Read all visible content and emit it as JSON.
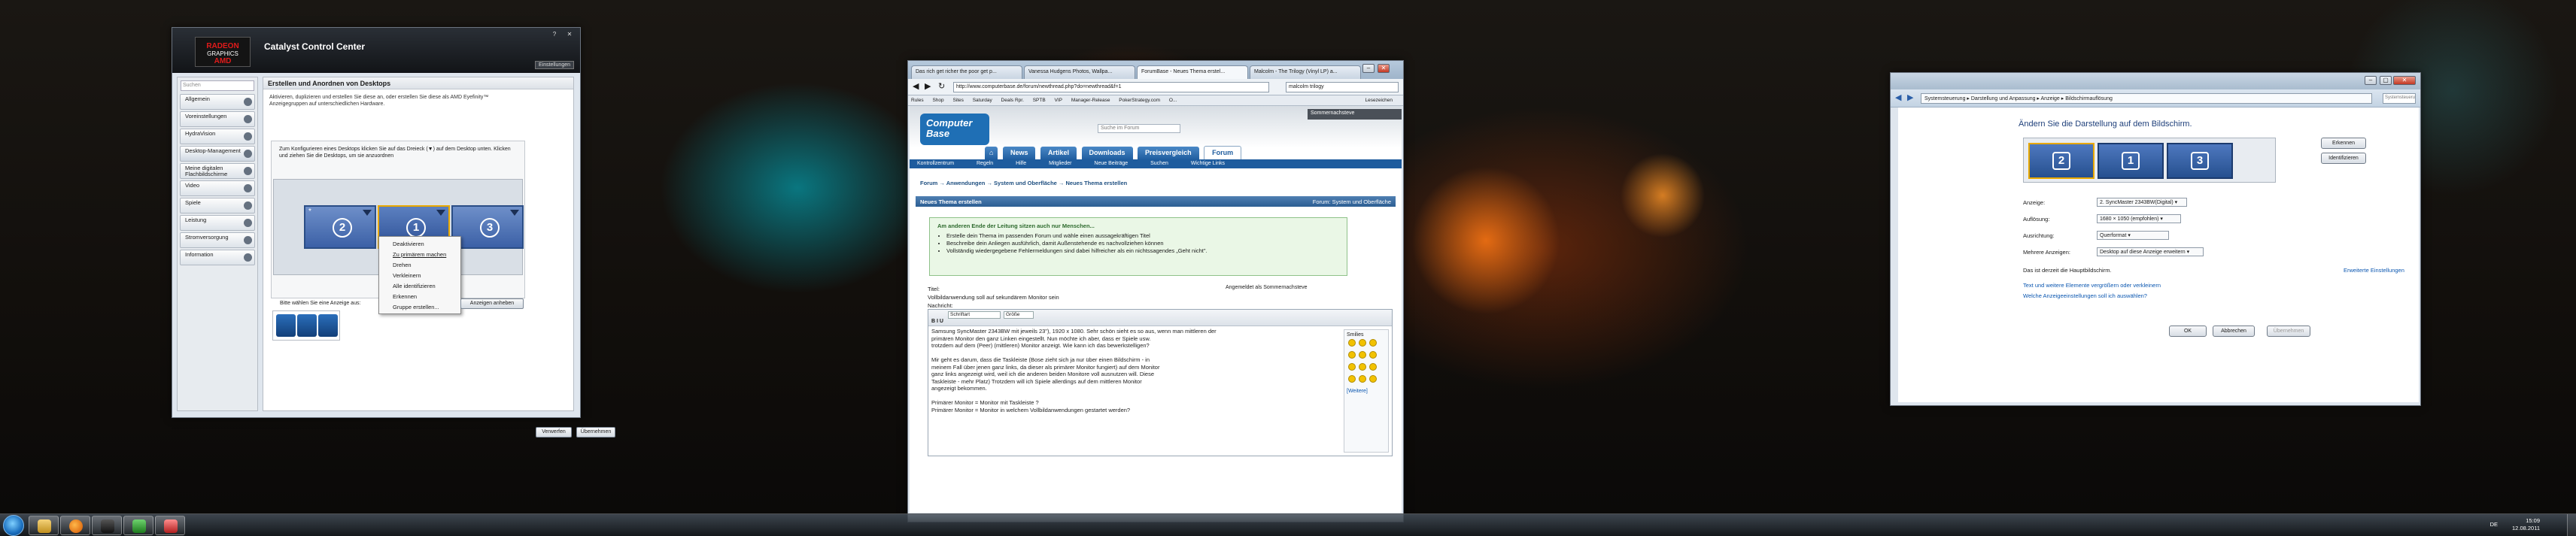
{
  "ccc": {
    "logo_line1": "RADEON",
    "logo_line2": "GRAPHICS",
    "brand": "AMD",
    "title": "Catalyst Control Center",
    "preferences": "Einstellungen",
    "search_placeholder": "Suchen",
    "sidebar": [
      "Allgemein",
      "Voreinstellungen",
      "HydraVision",
      "Desktop-Management",
      "Meine digitalen Flachbildschirme",
      "Video",
      "Spiele",
      "Leistung",
      "Stromversorgung",
      "Information"
    ],
    "heading": "Erstellen und Anordnen von Desktops",
    "description": "Aktivieren, duplizieren und erstellen Sie diese an, oder erstellen Sie diese als AMD Eyefinity™ Anzeigegruppen auf unterschiedlichen Hardware.",
    "instruction": "Zum Konfigurieren eines Desktops klicken Sie auf das Dreieck (▼) auf dem Desktop unten. Klicken und ziehen Sie die Desktops, um sie anzuordnen",
    "monitors": [
      "2",
      "1",
      "3"
    ],
    "context_menu": [
      "Deaktivieren",
      "Zu primärem machen",
      "Drehen",
      "Verkleinern",
      "Alle identifizieren",
      "Erkennen",
      "Gruppe erstellen..."
    ],
    "select_label": "Bitte wählen Sie eine Anzeige aus:",
    "hide_btn": "Anzeigen anheben",
    "discard_btn": "Verwerfen",
    "apply_btn": "Übernehmen"
  },
  "browser": {
    "tabs": [
      "Das rich get richer the poor get p...",
      "Vanessa Hudgens Photos, Wallpa...",
      "ForumBase - Neues Thema erstel...",
      "Malcolm - The Trilogy (Vinyl LP) a..."
    ],
    "url": "http://www.computerbase.de/forum/newthread.php?do=newthread&f=1",
    "search": "malcolm trilogy",
    "bookmarks": [
      "Rules",
      "Shop",
      "Sites",
      "Saturday",
      "Deals Rpr.",
      "SPTB",
      "VIP",
      "Manager-Release",
      "PokerStrategy.com",
      "O...",
      "Lesezeichen"
    ],
    "logo": "Computer Base",
    "user": "Sommernachsteve",
    "site_search": "Suche im Forum",
    "nav": [
      "News",
      "Artikel",
      "Downloads",
      "Preisvergleich",
      "Forum"
    ],
    "subnav": [
      "Kontrollzentrum",
      "Regeln",
      "Hilfe",
      "Mitglieder",
      "Neue Beiträge",
      "Suchen",
      "Wichtige Links"
    ],
    "breadcrumb": "Forum → Anwendungen → System und Oberfläche → Neues Thema erstellen",
    "section": "Neues Thema erstellen",
    "section_right": "Forum: System und Oberfläche",
    "notice_title": "Am anderen Ende der Leitung sitzen auch nur Menschen...",
    "notice_items": [
      "Erstelle dein Thema im passenden Forum und wähle einen aussagekräftigen Titel",
      "Beschreibe dein Anliegen ausführlich, damit Außenstehende es nachvollziehen können",
      "Vollständig wiedergegebene Fehlermeldungen sind dabei hilfreicher als ein nichtssagendes „Geht nicht\"."
    ],
    "title_label": "Titel:",
    "title_value": "Vollbildanwendung soll auf sekundärem Monitor sein",
    "logged_in": "Angemeldet als Sommernachsteve",
    "message_label": "Nachricht:",
    "font": "Schriftart",
    "size": "Größe",
    "body": [
      "Samsung SyncMaster 2343BW mit jeweils 23\"), 1920 x 1080. Sehr schön sieht es so aus, wenn man mittleren der",
      "primären Monitor den ganz Linken eingestellt. Nun möchte ich aber, dass er Spiele usw.",
      "trotzdem auf dem (Peer) (mittleren) Monitor anzeigt. Wie kann ich das bewerkstelligen?",
      "",
      "Mir geht es darum, dass die Taskleiste (Bose zieht sich ja nur über einen Bildschirm - in",
      "meinem Fall über jenen ganz links, da dieser als primärer Monitor fungiert) auf dem Monitor",
      "ganz links angezeigt wird, weil ich die anderen beiden Monitore voll ausnutzen will. Diese",
      "Taskleiste - mehr Platz) Trotzdem will ich Spiele allerdings auf dem mittleren Monitor",
      "angezeigt bekommen.",
      "",
      "Primärer Monitor = Monitor mit Taskleiste ?",
      "Primärer Monitor = Monitor in welchem Vollbildanwendungen gestartet werden?"
    ],
    "smilies_title": "Smilies",
    "smilies_more": "[Weitere]"
  },
  "display": {
    "crumb": "Systemsteuerung ▸ Darstellung und Anpassung ▸ Anzeige ▸ Bildschirmauflösung",
    "search": "Systemsteuerung durchsuchen",
    "heading": "Ändern Sie die Darstellung auf dem Bildschirm.",
    "monitors": [
      "2",
      "1",
      "3"
    ],
    "detect": "Erkennen",
    "identify": "Identifizieren",
    "rows": [
      {
        "label": "Anzeige:",
        "value": "2. SyncMaster 2343BW(Digital) ▾"
      },
      {
        "label": "Auflösung:",
        "value": "1680 × 1050 (empfohlen) ▾"
      },
      {
        "label": "Ausrichtung:",
        "value": "Querformat ▾"
      },
      {
        "label": "Mehrere Anzeigen:",
        "value": "Desktop auf diese Anzeige erweitern ▾"
      }
    ],
    "primary_note": "Das ist derzeit die Hauptbildschirm.",
    "advanced": "Erweiterte Einstellungen",
    "links": [
      "Text und weitere Elemente vergrößern oder verkleinern",
      "Welche Anzeigeeinstellungen soll ich auswählen?"
    ],
    "ok": "OK",
    "cancel": "Abbrechen",
    "apply": "Übernehmen"
  },
  "tray": {
    "lang": "DE",
    "time": "15:09",
    "date": "12.08.2011"
  },
  "colors": {
    "accent": "#1e5c9e",
    "amd_red": "#e11b1b",
    "notice_green": "#eaf7e6"
  }
}
